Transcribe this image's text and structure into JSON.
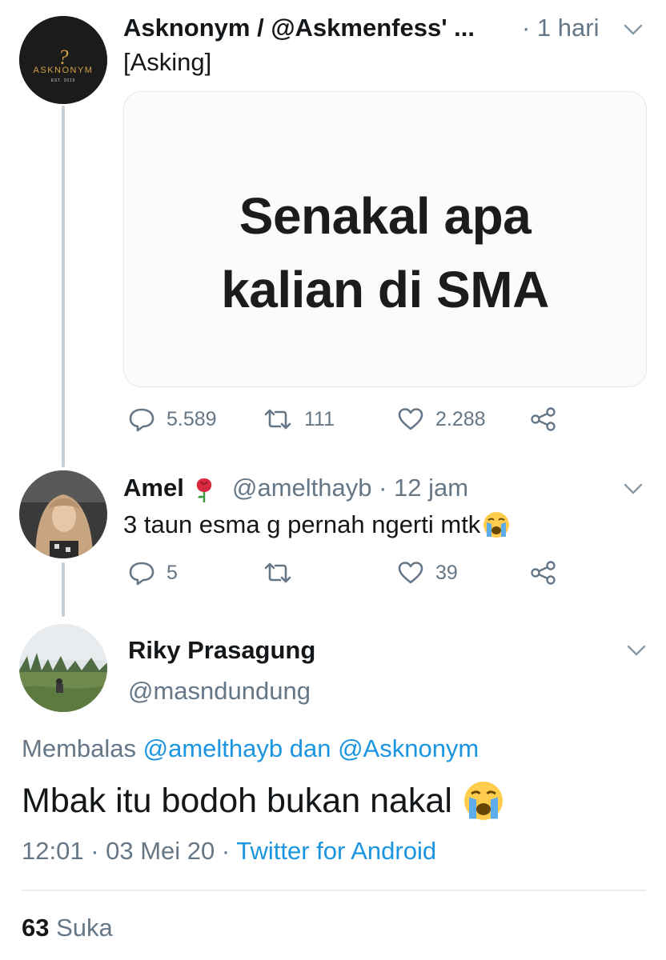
{
  "thread": {
    "original": {
      "display_name": "Asknonym / @Askmenfess' ...",
      "time": "· 1 hari",
      "text": "[Asking]",
      "avatar_logo_text": "ASKNONYM",
      "avatar_logo_sub": "EST. 2019",
      "avatar_logo_mark": "?",
      "media_lines": [
        "Senakal apa",
        "kalian di SMA"
      ],
      "replies": "5.589",
      "retweets": "111",
      "likes": "2.288"
    },
    "reply": {
      "display_name": "Amel",
      "handle_time": "@amelthayb · 12 jam",
      "text": "3 taun esma g pernah ngerti mtk",
      "replies": "5",
      "retweets": "",
      "likes": "39"
    },
    "focus": {
      "display_name": "Riky Prasagung",
      "handle": "@masndundung",
      "reply_prefix": "Membalas",
      "reply_users": "@amelthayb dan @Asknonym",
      "text": "Mbak itu bodoh bukan nakal",
      "timestamp": "12:01 · 03 Mei 20 ·",
      "source": "Twitter for Android",
      "likes_count": "63",
      "likes_label": "Suka"
    }
  },
  "colors": {
    "link": "#1b95e0",
    "muted": "#657786",
    "thread_line": "#c4cfd6"
  },
  "icons": [
    "reply-icon",
    "retweet-icon",
    "like-icon",
    "share-icon",
    "chevron-down-icon",
    "crying-emoji-icon",
    "rose-emoji-icon"
  ]
}
